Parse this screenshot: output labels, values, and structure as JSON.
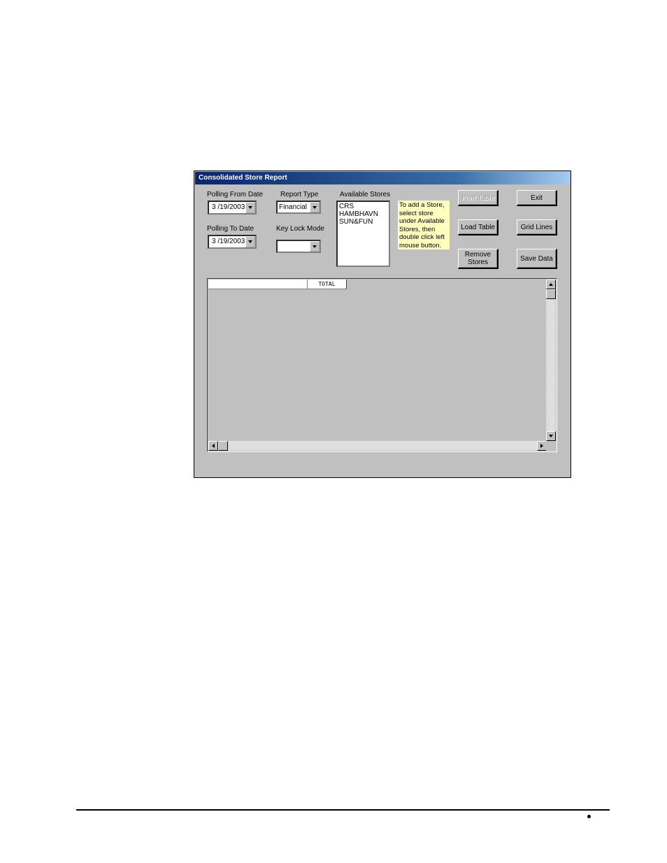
{
  "window": {
    "title": "Consolidated Store Report"
  },
  "form": {
    "polling_from": {
      "label": "Polling From Date",
      "value": "3 /19/2003"
    },
    "polling_to": {
      "label": "Polling To Date",
      "value": "3 /19/2003"
    },
    "report_type": {
      "label": "Report Type",
      "value": "Financial"
    },
    "key_lock_mode": {
      "label": "Key Lock Mode",
      "value": ""
    },
    "available_stores": {
      "label": "Available Stores",
      "items": [
        "CRS",
        "HAMBHAVN",
        "SUN&FUN"
      ]
    },
    "hint": "To add a Store, select store under Available Stores, then double click left mouse button."
  },
  "buttons": {
    "print_table": "Print Table",
    "exit": "Exit",
    "load_table": "Load Table",
    "grid_lines": "Grid Lines",
    "remove_stores": "Remove Stores",
    "save_data": "Save Data"
  },
  "grid": {
    "header_total": "TOTAL"
  },
  "colors": {
    "title_bar": "#0a246a",
    "window_bg": "#c0c0c0",
    "hint_bg": "#ffffc0"
  },
  "icons": [
    "dropdown-arrow-icon",
    "scroll-up-arrow-icon",
    "scroll-down-arrow-icon",
    "scroll-left-arrow-icon",
    "scroll-right-arrow-icon",
    "bullet-icon"
  ]
}
